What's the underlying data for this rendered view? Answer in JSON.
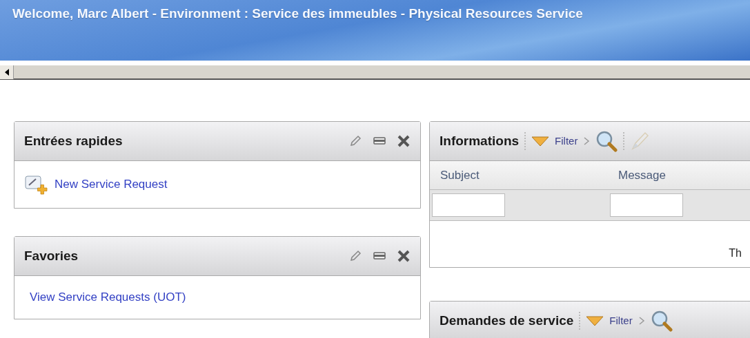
{
  "window": {
    "title": "Welcome, Marc Albert - Environment : Service des immeubles - Physical Resources Service"
  },
  "left_panels": [
    {
      "title": "Entrées rapides",
      "links": [
        {
          "label": "New Service Request",
          "kind": "icon"
        }
      ]
    },
    {
      "title": "Favories",
      "links": [
        {
          "label": "View Service Requests (UOT)",
          "kind": "plain"
        }
      ]
    }
  ],
  "right_panels": [
    {
      "title": "Informations",
      "filter_label": "Filter",
      "clear_disabled": true,
      "table": {
        "columns": [
          "Subject",
          "Message"
        ],
        "message": "Th"
      }
    },
    {
      "title": "Demandes de service",
      "filter_label": "Filter"
    }
  ]
}
